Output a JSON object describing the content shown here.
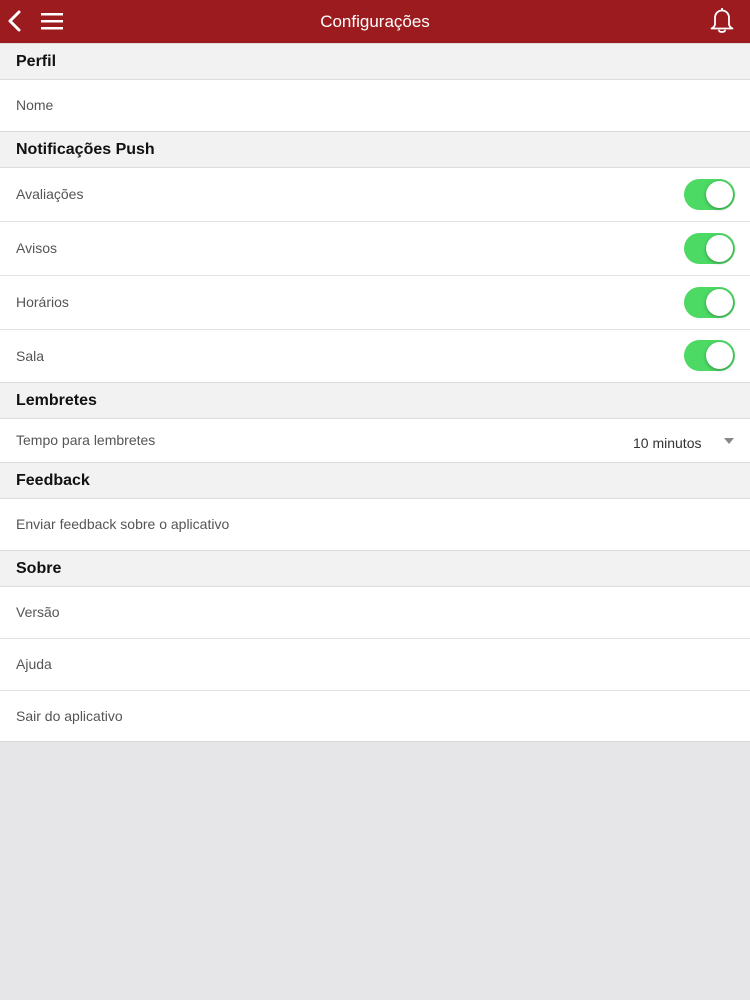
{
  "header": {
    "title": "Configurações",
    "background": "#9c1b1e"
  },
  "sections": {
    "perfil": {
      "title": "Perfil",
      "items": [
        "Nome"
      ]
    },
    "push": {
      "title": "Notificações Push",
      "items": [
        {
          "label": "Avaliações",
          "enabled": true
        },
        {
          "label": "Avisos",
          "enabled": true
        },
        {
          "label": "Horários",
          "enabled": true
        },
        {
          "label": "Sala",
          "enabled": true
        }
      ]
    },
    "lembretes": {
      "title": "Lembretes",
      "reminder_label": "Tempo para lembretes",
      "reminder_value": "10 minutos"
    },
    "feedback": {
      "title": "Feedback",
      "items": [
        "Enviar feedback sobre o aplicativo"
      ]
    },
    "sobre": {
      "title": "Sobre",
      "items": [
        "Versão",
        "Ajuda",
        "Sair do aplicativo"
      ]
    }
  },
  "colors": {
    "accent": "#9c1b1e",
    "toggle_on": "#4cd964",
    "section_bg": "#f2f2f2",
    "empty_area": "#e6e6e8"
  },
  "icons": [
    "back-icon",
    "menu-icon",
    "bell-icon",
    "caret-down-icon"
  ]
}
